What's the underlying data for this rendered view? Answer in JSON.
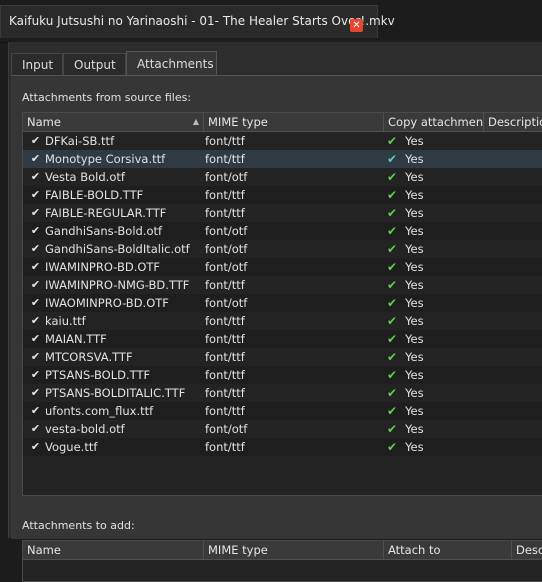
{
  "window": {
    "title": "Kaifuku Jutsushi no Yarinaoshi - 01- The Healer Starts Over!.mkv",
    "close_glyph": "✕"
  },
  "tabs": [
    {
      "label": "Input",
      "active": false
    },
    {
      "label": "Output",
      "active": false
    },
    {
      "label": "Attachments",
      "active": true
    }
  ],
  "source_section": {
    "label": "Attachments from source files:",
    "columns": [
      "Name",
      "MIME type",
      "Copy attachment",
      "Description"
    ],
    "sort_indicator": "▲",
    "check_glyph": "✔",
    "rows": [
      {
        "name": "DFKai-SB.ttf",
        "mime": "font/ttf",
        "copy": "Yes"
      },
      {
        "name": "Monotype Corsiva.ttf",
        "mime": "font/ttf",
        "copy": "Yes"
      },
      {
        "name": "Vesta Bold.otf",
        "mime": "font/otf",
        "copy": "Yes"
      },
      {
        "name": "FAIBLE-BOLD.TTF",
        "mime": "font/ttf",
        "copy": "Yes"
      },
      {
        "name": "FAIBLE-REGULAR.TTF",
        "mime": "font/ttf",
        "copy": "Yes"
      },
      {
        "name": "GandhiSans-Bold.otf",
        "mime": "font/otf",
        "copy": "Yes"
      },
      {
        "name": "GandhiSans-BoldItalic.otf",
        "mime": "font/otf",
        "copy": "Yes"
      },
      {
        "name": "IWAMINPRO-BD.OTF",
        "mime": "font/otf",
        "copy": "Yes"
      },
      {
        "name": "IWAMINPRO-NMG-BD.TTF",
        "mime": "font/ttf",
        "copy": "Yes"
      },
      {
        "name": "IWAOMINPRO-BD.OTF",
        "mime": "font/otf",
        "copy": "Yes"
      },
      {
        "name": "kaiu.ttf",
        "mime": "font/ttf",
        "copy": "Yes"
      },
      {
        "name": "MAIAN.TTF",
        "mime": "font/ttf",
        "copy": "Yes"
      },
      {
        "name": "MTCORSVA.TTF",
        "mime": "font/ttf",
        "copy": "Yes"
      },
      {
        "name": "PTSANS-BOLD.TTF",
        "mime": "font/ttf",
        "copy": "Yes"
      },
      {
        "name": "PTSANS-BOLDITALIC.TTF",
        "mime": "font/ttf",
        "copy": "Yes"
      },
      {
        "name": "ufonts.com_flux.ttf",
        "mime": "font/ttf",
        "copy": "Yes"
      },
      {
        "name": "vesta-bold.otf",
        "mime": "font/otf",
        "copy": "Yes"
      },
      {
        "name": "Vogue.ttf",
        "mime": "font/ttf",
        "copy": "Yes"
      }
    ]
  },
  "add_section": {
    "label": "Attachments to add:",
    "columns": [
      "Name",
      "MIME type",
      "Attach to",
      "Description"
    ]
  },
  "colors": {
    "yes_check": "#5fcf4d",
    "selected_check": "#63c8c0",
    "close_button": "#e8452f"
  }
}
